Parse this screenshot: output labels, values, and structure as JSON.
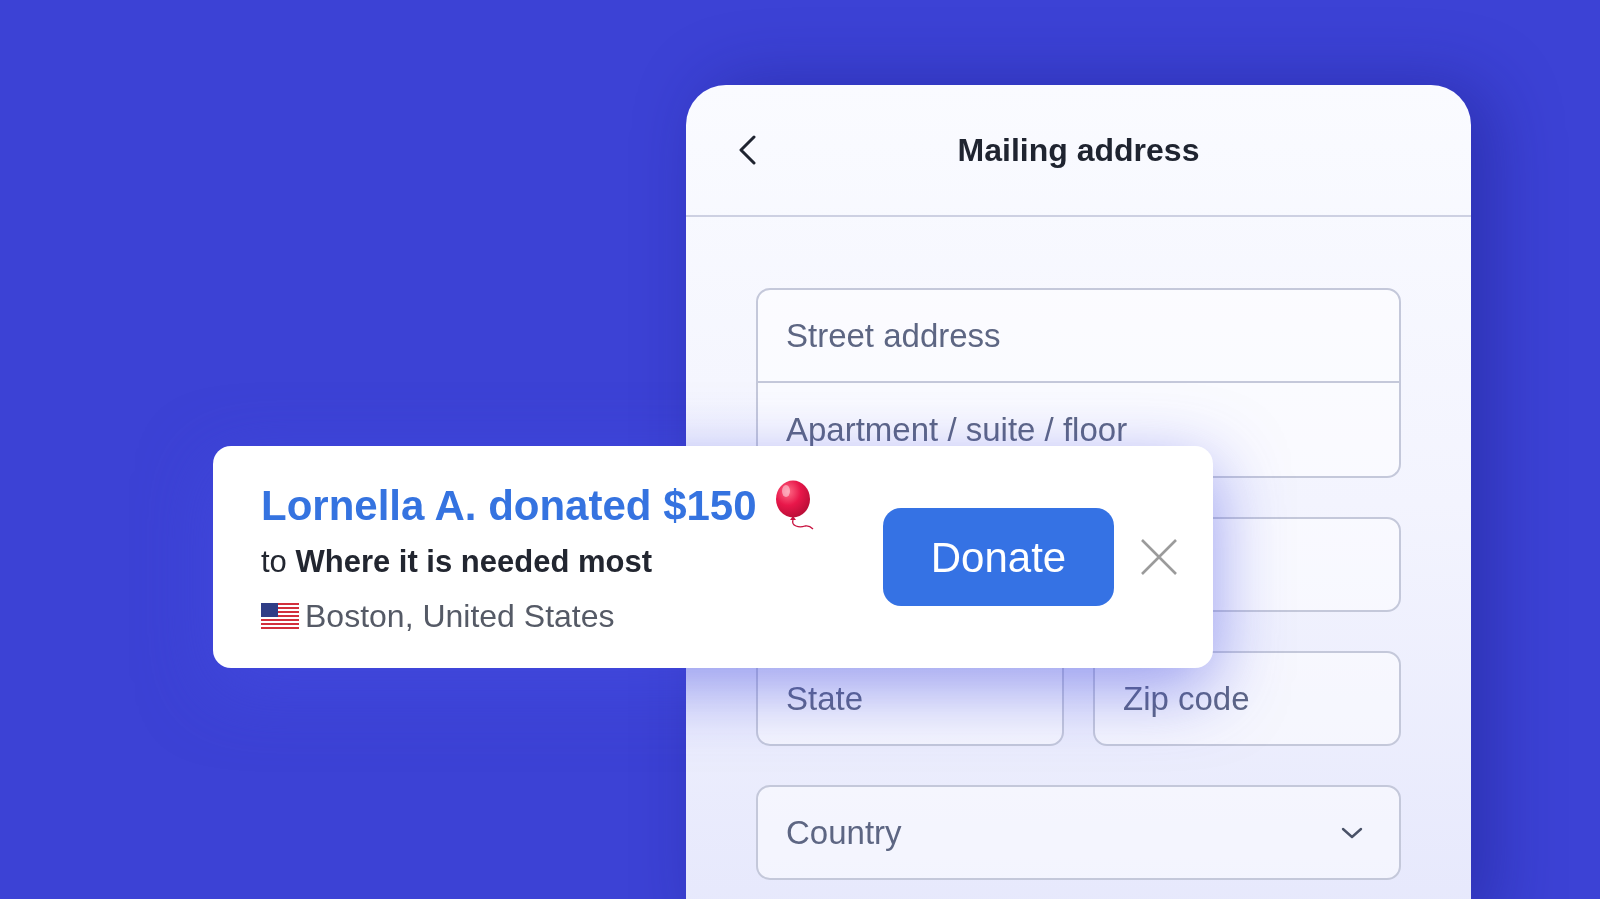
{
  "panel": {
    "title": "Mailing address",
    "field_groups": [
      {
        "kind": "stacked",
        "fields": [
          {
            "kind": "text",
            "placeholder": "Street address"
          },
          {
            "kind": "text",
            "placeholder": "Apartment / suite / floor"
          }
        ]
      },
      {
        "kind": "stacked",
        "fields": [
          {
            "kind": "text"
          }
        ]
      },
      {
        "kind": "row",
        "fields": [
          {
            "kind": "text",
            "placeholder": "State"
          },
          {
            "kind": "text",
            "placeholder": "Zip code"
          }
        ]
      },
      {
        "kind": "stacked",
        "fields": [
          {
            "kind": "select",
            "placeholder": "Country"
          }
        ]
      }
    ]
  },
  "notification": {
    "headline": "Lornella A. donated $150",
    "designation": "to **Where it is needed most**",
    "location": "Boston, United States",
    "button": "Donate"
  }
}
